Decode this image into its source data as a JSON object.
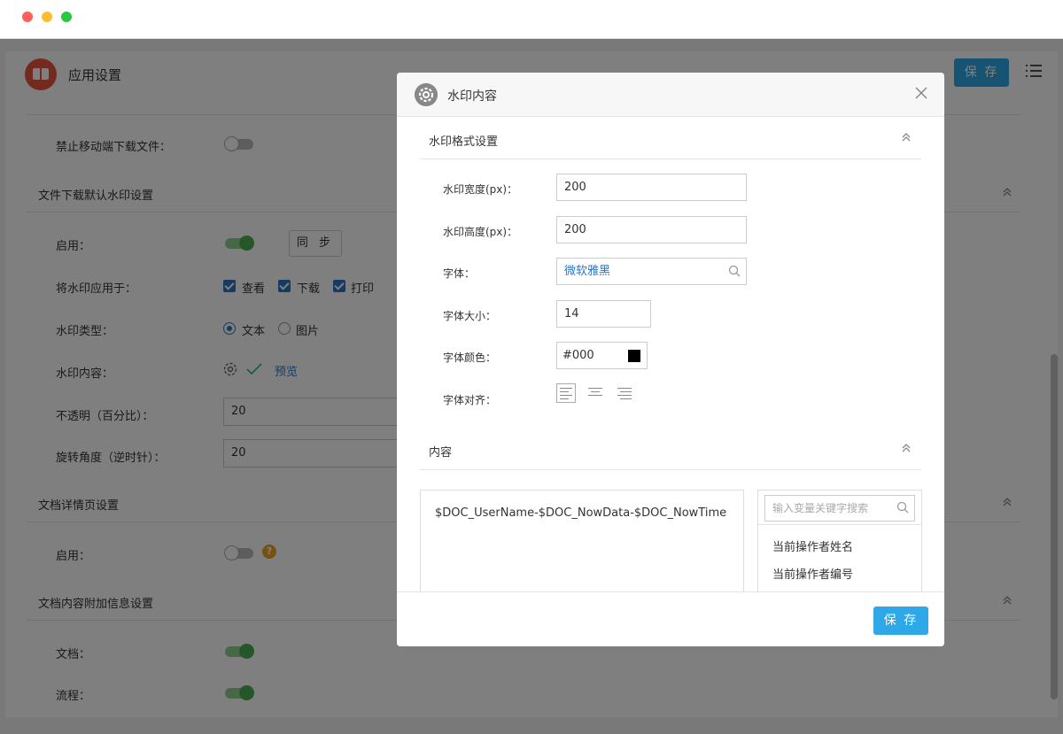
{
  "app": {
    "title": "应用设置",
    "save_label": "保 存"
  },
  "background": {
    "sections": [
      {
        "title": "文件下载默认水印设置"
      },
      {
        "title": "文档详情页设置"
      },
      {
        "title": "文档内容附加信息设置"
      }
    ],
    "rows": {
      "disable_mobile_download": "禁止移动端下载文件：",
      "enable": "启用：",
      "sync_label": "同 步",
      "apply_to": "将水印应用于：",
      "apply_options": [
        "查看",
        "下载",
        "打印"
      ],
      "type": "水印类型：",
      "type_options": [
        "文本",
        "图片"
      ],
      "content": "水印内容：",
      "preview": "预览",
      "opacity": "不透明（百分比）：",
      "opacity_value": "20",
      "rotation": "旋转角度（逆时针）：",
      "rotation_value": "20",
      "detail_enable": "启用：",
      "doc": "文档：",
      "flow": "流程："
    },
    "help_mark": "?"
  },
  "modal": {
    "title": "水印内容",
    "format_section": "水印格式设置",
    "fields": {
      "width_label": "水印宽度(px)：",
      "width_value": "200",
      "height_label": "水印高度(px)：",
      "height_value": "200",
      "font_label": "字体：",
      "font_value": "微软雅黑",
      "size_label": "字体大小：",
      "size_value": "14",
      "color_label": "字体颜色：",
      "color_value": "#000",
      "align_label": "字体对齐："
    },
    "content_section": "内容",
    "content_text": "$DOC_UserName-$DOC_NowData-$DOC_NowTime",
    "var_search_placeholder": "输入变量关键字搜索",
    "variables": [
      "当前操作者姓名",
      "当前操作者编号"
    ],
    "save_label": "保 存"
  },
  "colors": {
    "accent": "#2ea8e6",
    "link": "#2a77c9",
    "toggle_on": "#4caf50"
  }
}
